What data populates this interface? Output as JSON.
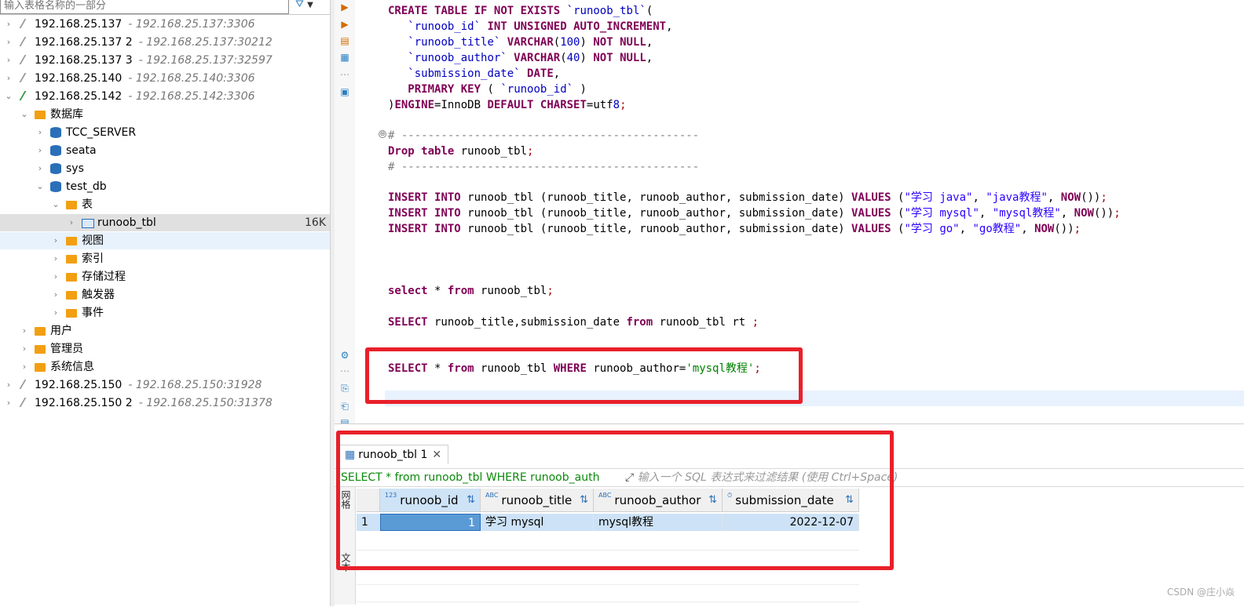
{
  "nav": {
    "filter_placeholder": "输入表格名称的一部分",
    "rows": [
      {
        "name": "192.168.25.137",
        "sub": "- 192.168.25.137:3306"
      },
      {
        "name": "192.168.25.137 2",
        "sub": "- 192.168.25.137:30212"
      },
      {
        "name": "192.168.25.137 3",
        "sub": "- 192.168.25.137:32597"
      },
      {
        "name": "192.168.25.140",
        "sub": "- 192.168.25.140:3306"
      },
      {
        "name": "192.168.25.142",
        "sub": "- 192.168.25.142:3306"
      },
      {
        "name": "数据库"
      },
      {
        "name": "TCC_SERVER"
      },
      {
        "name": "seata"
      },
      {
        "name": "sys"
      },
      {
        "name": "test_db"
      },
      {
        "name": "表"
      },
      {
        "name": "runoob_tbl",
        "size": "16K"
      },
      {
        "name": "视图"
      },
      {
        "name": "索引"
      },
      {
        "name": "存储过程"
      },
      {
        "name": "触发器"
      },
      {
        "name": "事件"
      },
      {
        "name": "用户"
      },
      {
        "name": "管理员"
      },
      {
        "name": "系统信息"
      },
      {
        "name": "192.168.25.150",
        "sub": "- 192.168.25.150:31928"
      },
      {
        "name": "192.168.25.150 2",
        "sub": "- 192.168.25.150:31378"
      }
    ]
  },
  "editor": {
    "lines": [
      "CREATE TABLE IF NOT EXISTS `runoob_tbl`(",
      "   `runoob_id` INT UNSIGNED AUTO_INCREMENT,",
      "   `runoob_title` VARCHAR(100) NOT NULL,",
      "   `runoob_author` VARCHAR(40) NOT NULL,",
      "   `submission_date` DATE,",
      "   PRIMARY KEY ( `runoob_id` )",
      ")ENGINE=InnoDB DEFAULT CHARSET=utf8;",
      "# ---------------------------------------------",
      "Drop table runoob_tbl;",
      "# ---------------------------------------------",
      "INSERT INTO runoob_tbl (runoob_title, runoob_author, submission_date) VALUES (\"学习 java\", \"java教程\", NOW());",
      "INSERT INTO runoob_tbl (runoob_title, runoob_author, submission_date) VALUES (\"学习 mysql\", \"mysql教程\", NOW());",
      "INSERT INTO runoob_tbl (runoob_title, runoob_author, submission_date) VALUES (\"学习 go\", \"go教程\", NOW());",
      "select * from runoob_tbl;",
      "SELECT runoob_title,submission_date from runoob_tbl rt ;",
      "SELECT * from runoob_tbl WHERE runoob_author='mysql教程';"
    ]
  },
  "results": {
    "tab_label": "runoob_tbl 1",
    "sql": "SELECT * from runoob_tbl WHERE runoob_auth",
    "filter_placeholder": "输入一个 SQL 表达式来过滤结果 (使用 Ctrl+Space)",
    "side_labels": [
      "网格",
      "文本"
    ],
    "columns": [
      {
        "type": "123",
        "name": "runoob_id"
      },
      {
        "type": "ABC",
        "name": "runoob_title"
      },
      {
        "type": "ABC",
        "name": "runoob_author"
      },
      {
        "type": "⏱",
        "name": "submission_date"
      }
    ],
    "rows": [
      {
        "num": "1",
        "cells": [
          "1",
          "学习 mysql",
          "mysql教程",
          "2022-12-07"
        ]
      }
    ]
  },
  "watermark": "CSDN @庄小焱"
}
